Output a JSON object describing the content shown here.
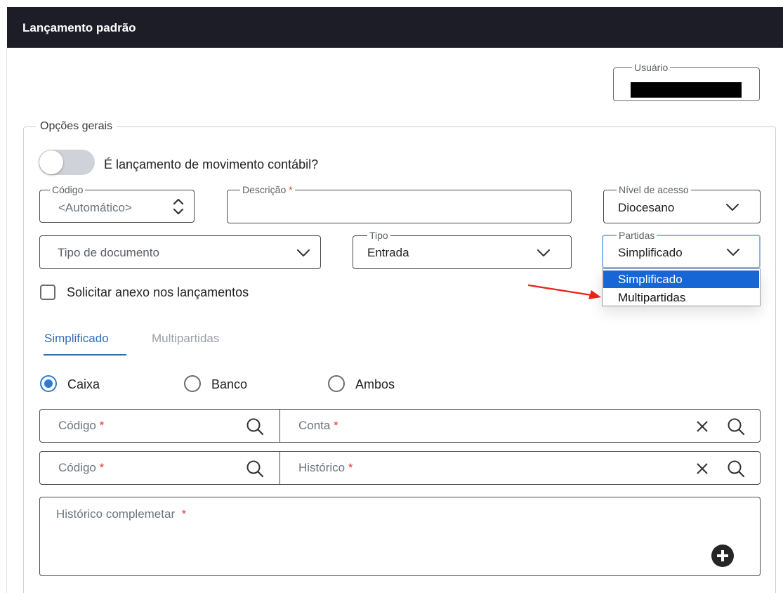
{
  "header": {
    "title": "Lançamento padrão"
  },
  "user_field": {
    "label": "Usuário",
    "value": ""
  },
  "general_options": {
    "legend": "Opções gerais",
    "toggle_label": "É lançamento de movimento contábil?",
    "toggle_on": false
  },
  "fields": {
    "codigo": {
      "label": "Código",
      "placeholder": "<Automático>"
    },
    "descricao": {
      "label": "Descrição",
      "required_mark": "*",
      "value": ""
    },
    "nivel_acesso": {
      "label": "Nível de acesso",
      "value": "Diocesano"
    },
    "tipo_documento": {
      "placeholder": "Tipo de documento"
    },
    "tipo": {
      "label": "Tipo",
      "value": "Entrada"
    },
    "partidas": {
      "label": "Partidas",
      "value": "Simplificado",
      "options": [
        "Simplificado",
        "Multipartidas"
      ],
      "highlighted": "Simplificado"
    }
  },
  "attachment_checkbox": {
    "label": "Solicitar anexo nos lançamentos",
    "checked": false
  },
  "tabs": [
    {
      "label": "Simplificado",
      "active": true
    },
    {
      "label": "Multipartidas",
      "active": false
    }
  ],
  "radios": [
    {
      "label": "Caixa",
      "selected": true
    },
    {
      "label": "Banco",
      "selected": false
    },
    {
      "label": "Ambos",
      "selected": false
    }
  ],
  "row_conta": {
    "codigo": "Código",
    "conta": "Conta",
    "required_mark": "*"
  },
  "row_historico": {
    "codigo": "Código",
    "historico": "Histórico",
    "required_mark": "*"
  },
  "complement": {
    "label": "Histórico complemetar",
    "required_mark": "*"
  },
  "colors": {
    "header_bg": "#1c1d26",
    "accent_blue": "#2f6fb6",
    "dropdown_highlight": "#1766d6",
    "required_red": "#e53935",
    "arrow_red": "#e8231b"
  }
}
